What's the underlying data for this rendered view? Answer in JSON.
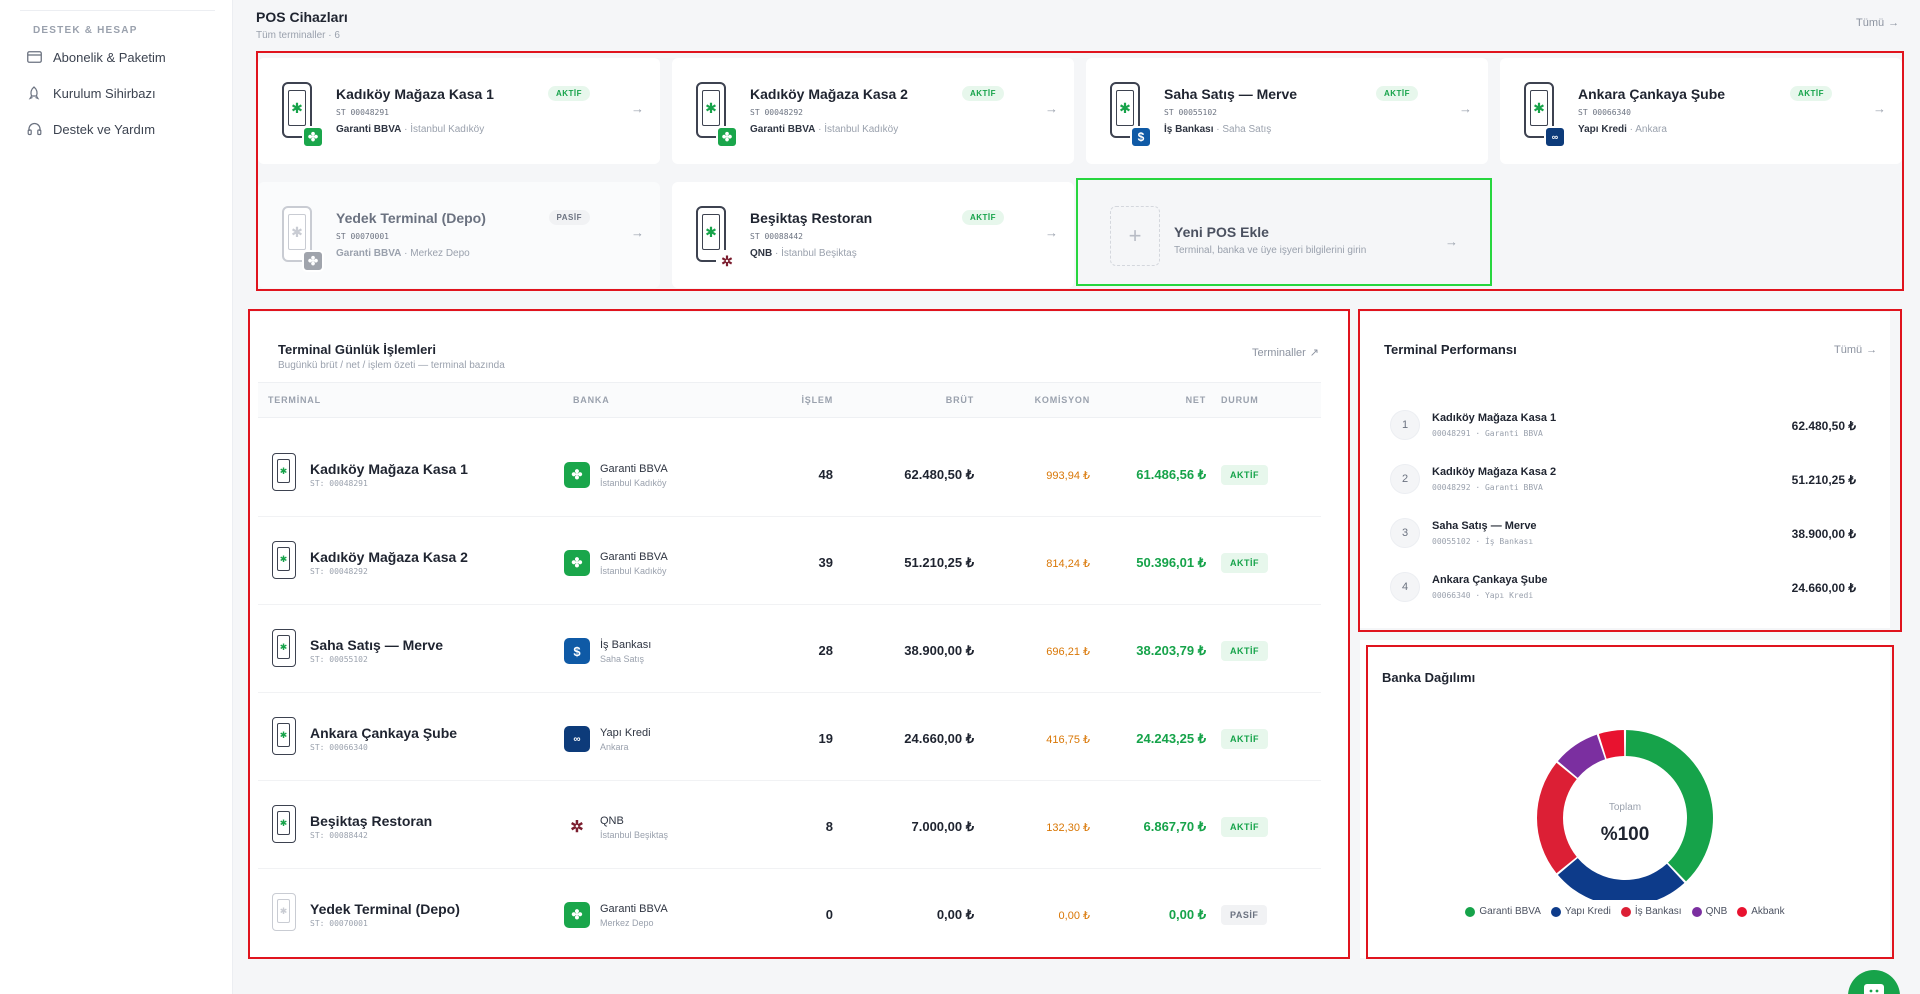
{
  "sidebar": {
    "section": "DESTEK & HESAP",
    "items": [
      {
        "label": "Abonelik & Paketim",
        "icon": "card-icon"
      },
      {
        "label": "Kurulum Sihirbazı",
        "icon": "rocket-icon"
      },
      {
        "label": "Destek ve Yardım",
        "icon": "headset-icon"
      }
    ]
  },
  "pos": {
    "title": "POS Cihazları",
    "subtitle": "Tüm terminaller · 6",
    "all_link": "Tümü",
    "cards": [
      {
        "name": "Kadıköy Mağaza Kasa 1",
        "st": "ST 00048291",
        "bank": "Garanti BBVA",
        "loc": " · İstanbul Kadıköy",
        "status": "AKTİF",
        "color": "#1aa64b"
      },
      {
        "name": "Kadıköy Mağaza Kasa 2",
        "st": "ST 00048292",
        "bank": "Garanti BBVA",
        "loc": " · İstanbul Kadıköy",
        "status": "AKTİF",
        "color": "#1aa64b"
      },
      {
        "name": "Saha Satış — Merve",
        "st": "ST 00055102",
        "bank": "İş Bankası",
        "loc": " · Saha Satış",
        "status": "AKTİF",
        "color": "#0f5aa6"
      },
      {
        "name": "Ankara Çankaya Şube",
        "st": "ST 00066340",
        "bank": "Yapı Kredi",
        "loc": " · Ankara",
        "status": "AKTİF",
        "color": "#0d3b7a"
      },
      {
        "name": "Yedek Terminal (Depo)",
        "st": "ST 00070001",
        "bank": "Garanti BBVA",
        "loc": " · Merkez Depo",
        "status": "PASİF",
        "color": "#a0a4ac"
      },
      {
        "name": "Beşiktaş Restoran",
        "st": "ST 00088442",
        "bank": "QNB",
        "loc": " · İstanbul Beşiktaş",
        "status": "AKTİF",
        "color": "#ffffff"
      }
    ],
    "new_card": {
      "title": "Yeni POS Ekle",
      "desc": "Terminal, banka ve üye işyeri bilgilerini girin"
    }
  },
  "transactions": {
    "title": "Terminal Günlük İşlemleri",
    "subtitle": "Bugünkü brüt / net / işlem özeti — terminal bazında",
    "link": "Terminaller",
    "headers": {
      "terminal": "TERMİNAL",
      "bank": "BANKA",
      "ops": "İŞLEM",
      "gross": "BRÜT",
      "commission": "KOMİSYON",
      "net": "NET",
      "status": "DURUM"
    },
    "rows": [
      {
        "name": "Kadıköy Mağaza Kasa 1",
        "st": "ST: 00048291",
        "bank": "Garanti BBVA",
        "loc": "İstanbul Kadıköy",
        "ops": "48",
        "gross": "62.480,50 ₺",
        "commission": "993,94 ₺",
        "net": "61.486,56 ₺",
        "status": "AKTİF"
      },
      {
        "name": "Kadıköy Mağaza Kasa 2",
        "st": "ST: 00048292",
        "bank": "Garanti BBVA",
        "loc": "İstanbul Kadıköy",
        "ops": "39",
        "gross": "51.210,25 ₺",
        "commission": "814,24 ₺",
        "net": "50.396,01 ₺",
        "status": "AKTİF"
      },
      {
        "name": "Saha Satış — Merve",
        "st": "ST: 00055102",
        "bank": "İş Bankası",
        "loc": "Saha Satış",
        "ops": "28",
        "gross": "38.900,00 ₺",
        "commission": "696,21 ₺",
        "net": "38.203,79 ₺",
        "status": "AKTİF"
      },
      {
        "name": "Ankara Çankaya Şube",
        "st": "ST: 00066340",
        "bank": "Yapı Kredi",
        "loc": "Ankara",
        "ops": "19",
        "gross": "24.660,00 ₺",
        "commission": "416,75 ₺",
        "net": "24.243,25 ₺",
        "status": "AKTİF"
      },
      {
        "name": "Beşiktaş Restoran",
        "st": "ST: 00088442",
        "bank": "QNB",
        "loc": "İstanbul Beşiktaş",
        "ops": "8",
        "gross": "7.000,00 ₺",
        "commission": "132,30 ₺",
        "net": "6.867,70 ₺",
        "status": "AKTİF"
      },
      {
        "name": "Yedek Terminal (Depo)",
        "st": "ST: 00070001",
        "bank": "Garanti BBVA",
        "loc": "Merkez Depo",
        "ops": "0",
        "gross": "0,00 ₺",
        "commission": "0,00 ₺",
        "net": "0,00 ₺",
        "status": "PASİF"
      }
    ]
  },
  "performance": {
    "title": "Terminal Performansı",
    "link": "Tümü",
    "rows": [
      {
        "rank": "1",
        "name": "Kadıköy Mağaza Kasa 1",
        "meta": "00048291 · Garanti BBVA",
        "value": "62.480,50 ₺"
      },
      {
        "rank": "2",
        "name": "Kadıköy Mağaza Kasa 2",
        "meta": "00048292 · Garanti BBVA",
        "value": "51.210,25 ₺"
      },
      {
        "rank": "3",
        "name": "Saha Satış — Merve",
        "meta": "00055102 · İş Bankası",
        "value": "38.900,00 ₺"
      },
      {
        "rank": "4",
        "name": "Ankara Çankaya Şube",
        "meta": "00066340 · Yapı Kredi",
        "value": "24.660,00 ₺"
      }
    ]
  },
  "bank_dist": {
    "title": "Banka Dağılımı",
    "center_label": "Toplam",
    "center_value": "%100"
  },
  "chart_data": {
    "type": "pie",
    "categories": [
      "Garanti BBVA",
      "Yapı Kredi",
      "İş Bankası",
      "QNB",
      "Akbank"
    ],
    "values": [
      38,
      26,
      22,
      9,
      5
    ],
    "colors": [
      "#16a34a",
      "#0d3b8a",
      "#dc1f35",
      "#7b2fa0",
      "#e8122f"
    ],
    "legend": "bottom"
  },
  "colors": {
    "accent": "#16a34a",
    "highlight_frame": "#e0141e",
    "new_frame": "#27d63f"
  }
}
